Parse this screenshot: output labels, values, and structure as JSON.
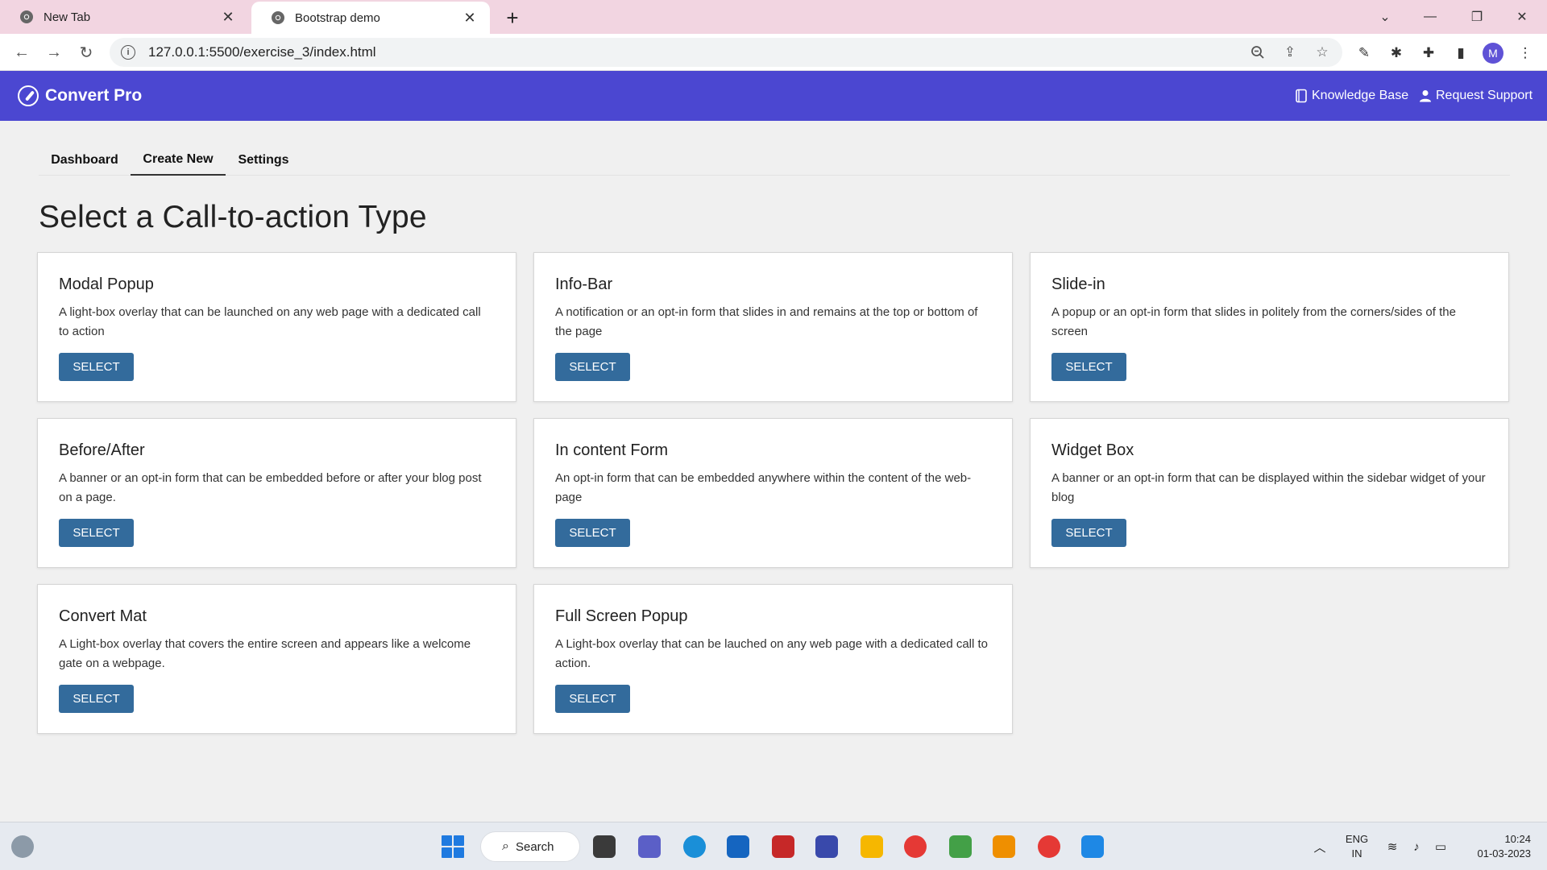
{
  "browser": {
    "tabs": [
      {
        "title": "New Tab"
      },
      {
        "title": "Bootstrap demo"
      }
    ],
    "address": "127.0.0.1:5500/exercise_3/index.html",
    "profile_initial": "M"
  },
  "navbar": {
    "brand": "Convert Pro",
    "links": [
      {
        "label": "Knowledge Base"
      },
      {
        "label": "Request Support"
      }
    ],
    "colors": {
      "background": "#4b47d1"
    }
  },
  "page_tabs": [
    {
      "label": "Dashboard"
    },
    {
      "label": "Create New",
      "active": true
    },
    {
      "label": "Settings"
    }
  ],
  "page_title": "Select a Call-to-action Type",
  "cards": [
    {
      "title": "Modal Popup",
      "description": "A light-box overlay that can be launched on any web page with a dedicated call to action",
      "button": "SELECT"
    },
    {
      "title": "Info-Bar",
      "description": "A notification or an opt-in form that slides in and remains at the top or bottom of the page",
      "button": "SELECT"
    },
    {
      "title": "Slide-in",
      "description": "A popup or an opt-in form that slides in politely from the corners/sides of the screen",
      "button": "SELECT"
    },
    {
      "title": "Before/After",
      "description": "A banner or an opt-in form that can be embedded before or after your blog post on a page.",
      "button": "SELECT"
    },
    {
      "title": "In content Form",
      "description": "An opt-in form that can be embedded anywhere within the content of the web-page",
      "button": "SELECT"
    },
    {
      "title": "Widget Box",
      "description": "A banner or an opt-in form that can be displayed within the sidebar widget of your blog",
      "button": "SELECT"
    },
    {
      "title": "Convert Mat",
      "description": "A Light-box overlay that covers the entire screen and appears like a welcome gate on a webpage.",
      "button": "SELECT"
    },
    {
      "title": "Full Screen Popup",
      "description": "A Light-box overlay that can be lauched on any web page with a dedicated call to action.",
      "button": "SELECT"
    }
  ],
  "button_color": "#336b9c",
  "taskbar": {
    "search_label": "Search",
    "language": "ENG",
    "region": "IN",
    "time": "10:24",
    "date": "01-03-2023"
  }
}
